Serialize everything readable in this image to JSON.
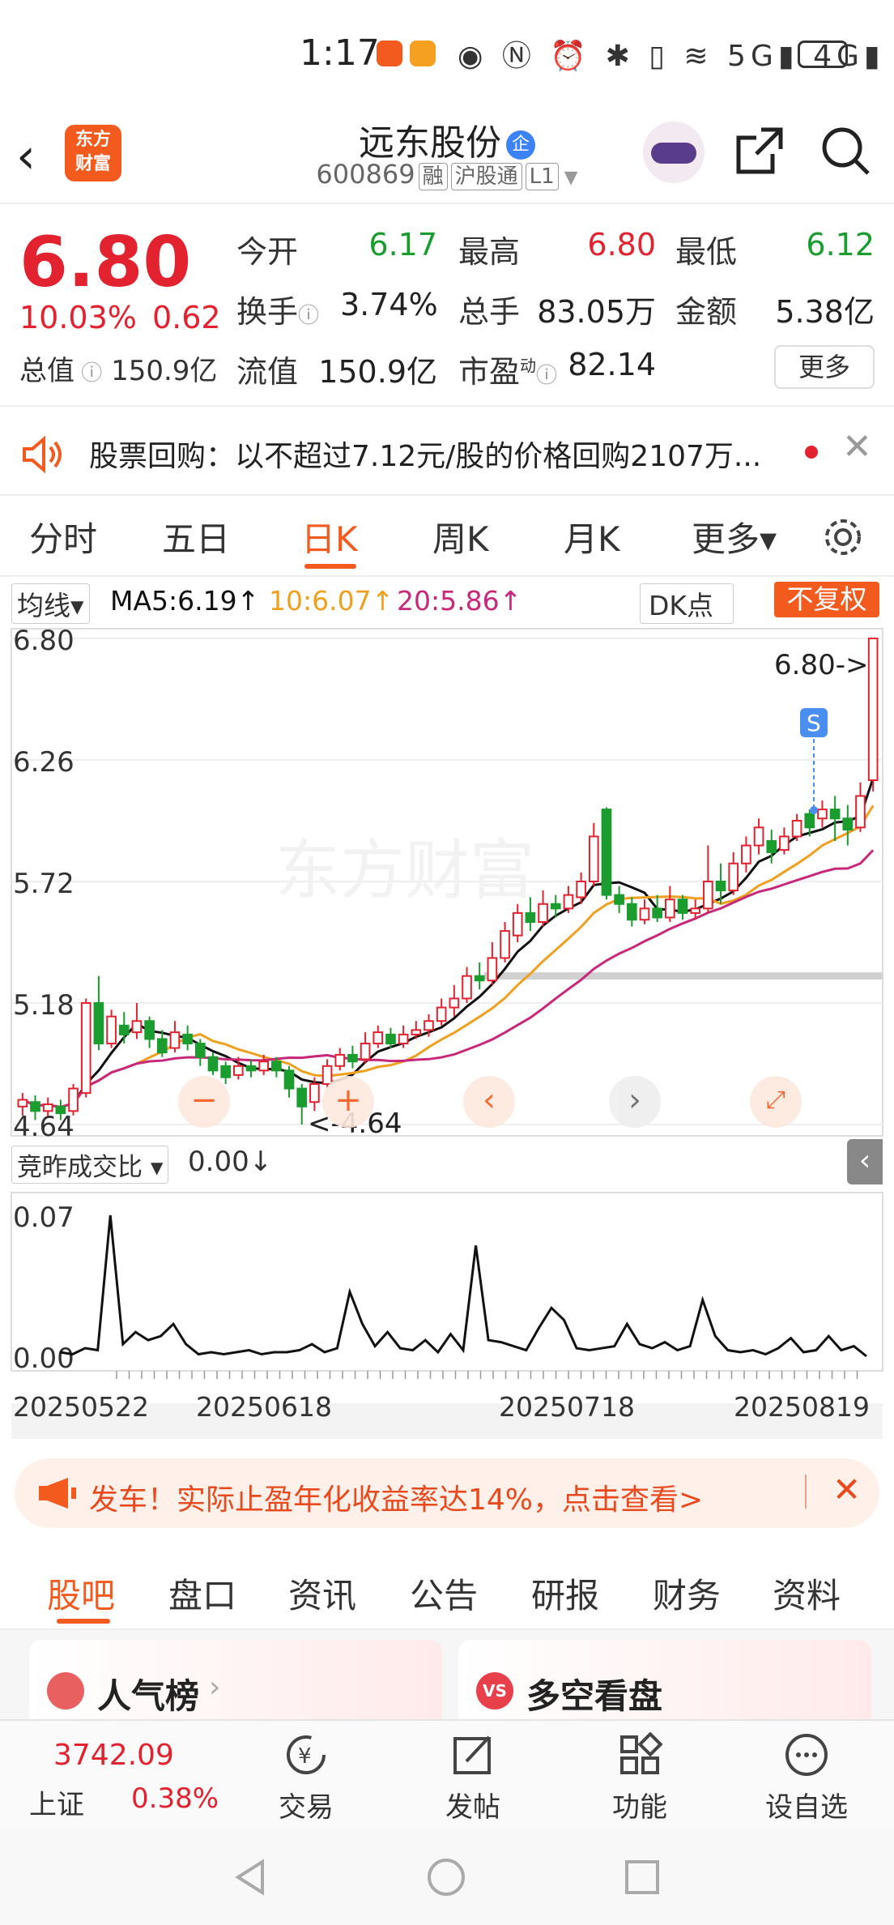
{
  "status": {
    "time": "1:17",
    "icons": "◉ Ⓝ ⏰ ✱ ▯ ≋ 5G▮ 4G▮"
  },
  "header": {
    "logo_line1": "东方",
    "logo_line2": "财富",
    "title": "远东股份",
    "title_badge": "企",
    "code": "600869",
    "tag_margin": "融",
    "tag_connect": "沪股通",
    "tag_level": "L1"
  },
  "quote": {
    "price": "6.80",
    "change_pct": "10.03%",
    "change": "0.62",
    "market_cap_label": "总值",
    "market_cap": "150.9亿",
    "open_label": "今开",
    "open": "6.17",
    "high_label": "最高",
    "high": "6.80",
    "low_label": "最低",
    "low": "6.12",
    "turnover_label": "换手",
    "turnover": "3.74%",
    "volume_label": "总手",
    "volume": "83.05万",
    "amount_label": "金额",
    "amount": "5.38亿",
    "float_label": "流值",
    "float": "150.9亿",
    "pe_label": "市盈",
    "pe_sup": "动",
    "pe": "82.14",
    "more": "更多"
  },
  "notice": {
    "text": "股票回购：以不超过7.12元/股的价格回购2107万..."
  },
  "tabs": [
    "分时",
    "五日",
    "日K",
    "周K",
    "月K",
    "更多▾"
  ],
  "active_tab": "日K",
  "chart_top": {
    "indicator": "均线▾",
    "ma5": "MA5:6.19↑",
    "ma10": "10:6.07↑",
    "ma20": "20:5.86↑",
    "dk": "DK点",
    "adjust": "不复权"
  },
  "volume_panel": {
    "label": "竞昨成交比 ▾",
    "value": "0.00↓"
  },
  "colors": {
    "up": "#e2222e",
    "down": "#1a9c2e",
    "ma5": "#111111",
    "ma10": "#f0a020",
    "ma20": "#c8287a",
    "accent": "#f25a1e"
  },
  "chart_data": [
    {
      "type": "candlestick",
      "y_ticks": [
        "6.80",
        "6.26",
        "5.72",
        "5.18",
        "4.64"
      ],
      "ylim": [
        4.64,
        6.8
      ],
      "high_label": "6.80->",
      "low_label": "<-4.64",
      "marker": "S",
      "x_ticks": [
        "20250522",
        "20250618",
        "20250718",
        "20250819"
      ],
      "candles": [
        [
          4.72,
          4.75,
          4.68,
          4.78
        ],
        [
          4.74,
          4.7,
          4.66,
          4.77
        ],
        [
          4.7,
          4.73,
          4.67,
          4.76
        ],
        [
          4.72,
          4.69,
          4.66,
          4.75
        ],
        [
          4.7,
          4.8,
          4.68,
          4.82
        ],
        [
          4.78,
          5.18,
          4.76,
          5.2
        ],
        [
          5.18,
          5.0,
          4.97,
          5.3
        ],
        [
          5.0,
          5.12,
          4.98,
          5.15
        ],
        [
          5.08,
          5.04,
          5.0,
          5.14
        ],
        [
          5.05,
          5.1,
          5.02,
          5.18
        ],
        [
          5.1,
          5.02,
          4.98,
          5.12
        ],
        [
          5.02,
          4.96,
          4.94,
          5.06
        ],
        [
          4.98,
          5.05,
          4.96,
          5.1
        ],
        [
          5.04,
          5.0,
          4.97,
          5.08
        ],
        [
          5.0,
          4.94,
          4.9,
          5.02
        ],
        [
          4.94,
          4.88,
          4.86,
          4.96
        ],
        [
          4.9,
          4.85,
          4.82,
          4.92
        ],
        [
          4.86,
          4.9,
          4.84,
          4.94
        ],
        [
          4.9,
          4.88,
          4.85,
          4.93
        ],
        [
          4.88,
          4.92,
          4.86,
          4.95
        ],
        [
          4.92,
          4.88,
          4.85,
          4.94
        ],
        [
          4.88,
          4.8,
          4.76,
          4.9
        ],
        [
          4.8,
          4.72,
          4.64,
          4.82
        ],
        [
          4.74,
          4.82,
          4.7,
          4.85
        ],
        [
          4.82,
          4.9,
          4.8,
          4.93
        ],
        [
          4.9,
          4.95,
          4.88,
          4.98
        ],
        [
          4.95,
          4.92,
          4.89,
          4.99
        ],
        [
          4.93,
          5.0,
          4.91,
          5.05
        ],
        [
          5.0,
          5.05,
          4.98,
          5.08
        ],
        [
          5.04,
          5.0,
          4.98,
          5.07
        ],
        [
          5.0,
          5.04,
          4.98,
          5.08
        ],
        [
          5.04,
          5.06,
          5.02,
          5.1
        ],
        [
          5.06,
          5.1,
          5.03,
          5.13
        ],
        [
          5.1,
          5.16,
          5.08,
          5.2
        ],
        [
          5.16,
          5.2,
          5.12,
          5.26
        ],
        [
          5.2,
          5.3,
          5.18,
          5.34
        ],
        [
          5.3,
          5.28,
          5.24,
          5.36
        ],
        [
          5.28,
          5.38,
          5.26,
          5.45
        ],
        [
          5.38,
          5.5,
          5.36,
          5.54
        ],
        [
          5.48,
          5.58,
          5.45,
          5.62
        ],
        [
          5.58,
          5.54,
          5.5,
          5.65
        ],
        [
          5.54,
          5.62,
          5.52,
          5.68
        ],
        [
          5.62,
          5.6,
          5.56,
          5.66
        ],
        [
          5.6,
          5.66,
          5.58,
          5.7
        ],
        [
          5.65,
          5.72,
          5.62,
          5.76
        ],
        [
          5.72,
          5.92,
          5.7,
          5.98
        ],
        [
          6.04,
          5.66,
          5.64,
          6.05
        ],
        [
          5.66,
          5.62,
          5.58,
          5.7
        ],
        [
          5.62,
          5.55,
          5.52,
          5.65
        ],
        [
          5.55,
          5.6,
          5.53,
          5.64
        ],
        [
          5.6,
          5.56,
          5.54,
          5.66
        ],
        [
          5.56,
          5.64,
          5.54,
          5.7
        ],
        [
          5.64,
          5.58,
          5.55,
          5.66
        ],
        [
          5.58,
          5.6,
          5.55,
          5.64
        ],
        [
          5.6,
          5.72,
          5.58,
          5.88
        ],
        [
          5.72,
          5.68,
          5.62,
          5.8
        ],
        [
          5.68,
          5.8,
          5.66,
          5.85
        ],
        [
          5.8,
          5.88,
          5.76,
          5.92
        ],
        [
          5.88,
          5.96,
          5.84,
          6.0
        ],
        [
          5.9,
          5.85,
          5.8,
          5.95
        ],
        [
          5.86,
          5.92,
          5.84,
          5.96
        ],
        [
          5.92,
          5.99,
          5.9,
          6.02
        ],
        [
          6.02,
          5.96,
          5.92,
          6.04
        ],
        [
          6.0,
          6.04,
          5.96,
          6.08
        ],
        [
          6.04,
          6.0,
          5.9,
          6.1
        ],
        [
          6.0,
          5.95,
          5.88,
          6.06
        ],
        [
          5.96,
          6.1,
          5.94,
          6.16
        ],
        [
          6.17,
          6.8,
          6.12,
          6.8
        ]
      ]
    },
    {
      "type": "line",
      "y_ticks": [
        "0.07",
        "0.00"
      ],
      "ylim": [
        0,
        0.07
      ],
      "values": [
        0.002,
        0.001,
        0.004,
        0.003,
        0.07,
        0.006,
        0.012,
        0.008,
        0.01,
        0.016,
        0.006,
        0.001,
        0.002,
        0.001,
        0.002,
        0.003,
        0.001,
        0.002,
        0.002,
        0.003,
        0.006,
        0.002,
        0.004,
        0.032,
        0.016,
        0.005,
        0.012,
        0.004,
        0.003,
        0.008,
        0.002,
        0.011,
        0.003,
        0.055,
        0.008,
        0.007,
        0.005,
        0.003,
        0.014,
        0.024,
        0.018,
        0.004,
        0.003,
        0.004,
        0.005,
        0.016,
        0.006,
        0.004,
        0.007,
        0.003,
        0.005,
        0.028,
        0.01,
        0.003,
        0.002,
        0.003,
        0.001,
        0.004,
        0.009,
        0.002,
        0.003,
        0.01,
        0.003,
        0.005,
        0.0
      ]
    }
  ],
  "ad": {
    "text": "发车！实际止盈年化收益率达14%，点击查看>"
  },
  "subtabs": [
    "股吧",
    "盘口",
    "资讯",
    "公告",
    "研报",
    "财务",
    "资料"
  ],
  "cards": {
    "left": "人气榜",
    "right": "多空看盘"
  },
  "bottom": {
    "index_value": "3742.09",
    "index_name": "上证",
    "index_pct": "0.38%",
    "trade": "交易",
    "post": "发帖",
    "func": "功能",
    "watch": "设自选"
  }
}
